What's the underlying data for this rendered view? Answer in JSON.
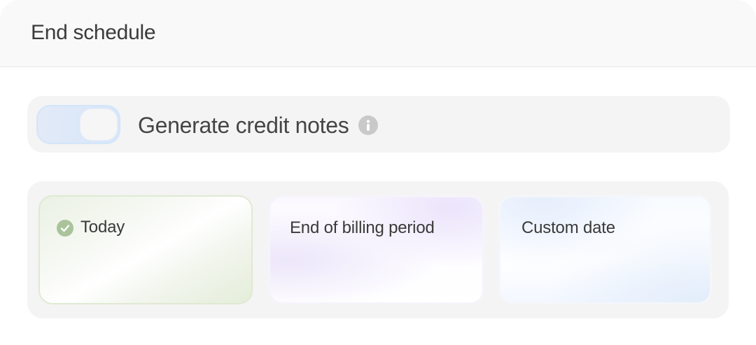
{
  "header": {
    "title": "End schedule"
  },
  "credit_notes": {
    "label": "Generate credit notes",
    "toggle_on": true,
    "info_icon": "info-icon"
  },
  "schedule_options": {
    "selected": "Today",
    "items": [
      {
        "label": "Today",
        "selected": true,
        "icon": "check-circle-icon",
        "accent": "#aac39b"
      },
      {
        "label": "End of billing period",
        "selected": false
      },
      {
        "label": "Custom date",
        "selected": false
      }
    ]
  }
}
